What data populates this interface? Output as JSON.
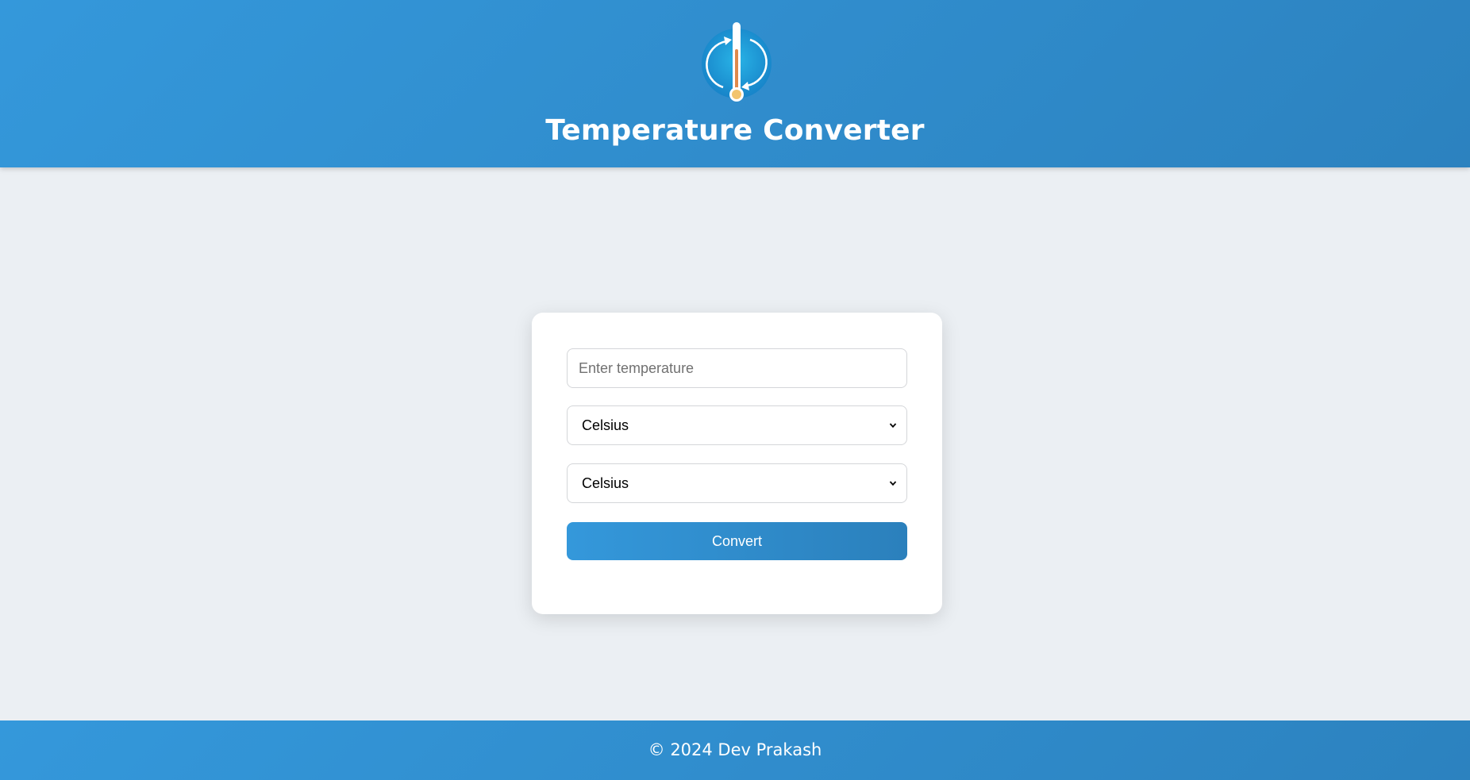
{
  "header": {
    "title": "Temperature Converter",
    "logo_icon": "thermometer-convert-icon"
  },
  "form": {
    "temperature_placeholder": "Enter temperature",
    "from_unit": "Celsius",
    "to_unit": "Celsius",
    "convert_label": "Convert"
  },
  "footer": {
    "copyright": "© 2024 Dev Prakash"
  },
  "colors": {
    "primary": "#3498db",
    "primary_dark": "#2c82bf",
    "page_background": "#ebeff3",
    "card_background": "#ffffff"
  }
}
